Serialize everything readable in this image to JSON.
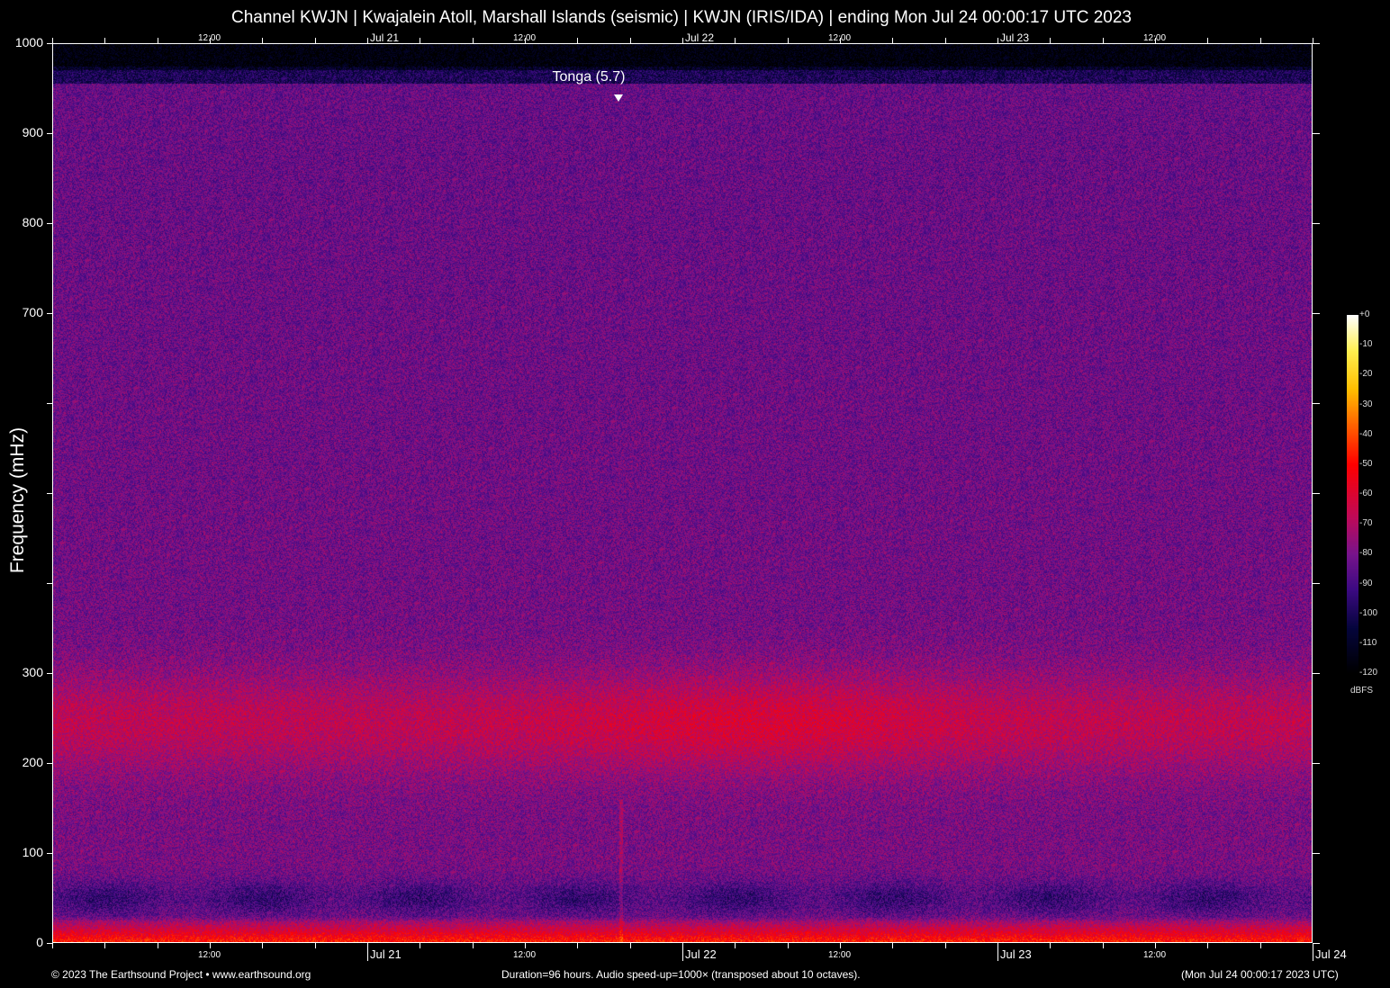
{
  "title": "Channel KWJN | Kwajalein Atoll, Marshall Islands (seismic) | KWJN (IRIS/IDA) | ending Mon Jul 24 00:00:17 UTC 2023",
  "footer": {
    "copyright": "© 2023 The Earthsound Project • www.earthsound.org",
    "duration": "Duration=96 hours. Audio speed-up=1000× (transposed about 10 octaves).",
    "timestamp": "(Mon Jul 24 00:00:17 2023 UTC)"
  },
  "colors": {
    "background": "#000000",
    "text": "#ffffff"
  },
  "chart_data": {
    "type": "heatmap",
    "title": "Channel KWJN | Kwajalein Atoll, Marshall Islands (seismic) | KWJN (IRIS/IDA) | ending Mon Jul 24 00:00:17 UTC 2023",
    "ylabel": "Frequency (mHz)",
    "ylim": [
      0,
      1000
    ],
    "xlim_hours": [
      0,
      96
    ],
    "y_ticks": [
      {
        "v": 1000,
        "label": "1000"
      },
      {
        "v": 900,
        "label": "900"
      },
      {
        "v": 800,
        "label": "800"
      },
      {
        "v": 700,
        "label": "700"
      },
      {
        "v": 600,
        "label": ""
      },
      {
        "v": 500,
        "label": ""
      },
      {
        "v": 400,
        "label": ""
      },
      {
        "v": 300,
        "label": "300"
      },
      {
        "v": 200,
        "label": "200"
      },
      {
        "v": 100,
        "label": "100"
      },
      {
        "v": 0,
        "label": "0"
      }
    ],
    "x_major": [
      {
        "h": 24,
        "label": "Jul 21"
      },
      {
        "h": 48,
        "label": "Jul 22"
      },
      {
        "h": 72,
        "label": "Jul 23"
      },
      {
        "h": 96,
        "label": "Jul 24"
      }
    ],
    "x_minor": [
      {
        "h": 12,
        "label": "12:00"
      },
      {
        "h": 36,
        "label": "12:00"
      },
      {
        "h": 60,
        "label": "12:00"
      },
      {
        "h": 84,
        "label": "12:00"
      }
    ],
    "x_tick_interval_hours": 4,
    "colorbar": {
      "label": "dBFS",
      "range": [
        -120,
        0
      ],
      "ticks": [
        "+0",
        "-10",
        "-20",
        "-30",
        "-40",
        "-50",
        "-60",
        "-70",
        "-80",
        "-90",
        "-100",
        "-110",
        "-120"
      ]
    },
    "annotations": [
      {
        "label": "Tonga (5.7)",
        "hour": 43.1
      }
    ],
    "bands": [
      {
        "fmin": 975,
        "fmax": 1000,
        "level_db": -118
      },
      {
        "fmin": 300,
        "fmax": 975,
        "level_db": -85
      },
      {
        "fmin": 180,
        "fmax": 300,
        "level_db": -65
      },
      {
        "fmin": 90,
        "fmax": 180,
        "level_db": -85
      },
      {
        "fmin": 30,
        "fmax": 90,
        "level_db": -95
      },
      {
        "fmin": 0,
        "fmax": 25,
        "level_db": -52
      }
    ]
  }
}
